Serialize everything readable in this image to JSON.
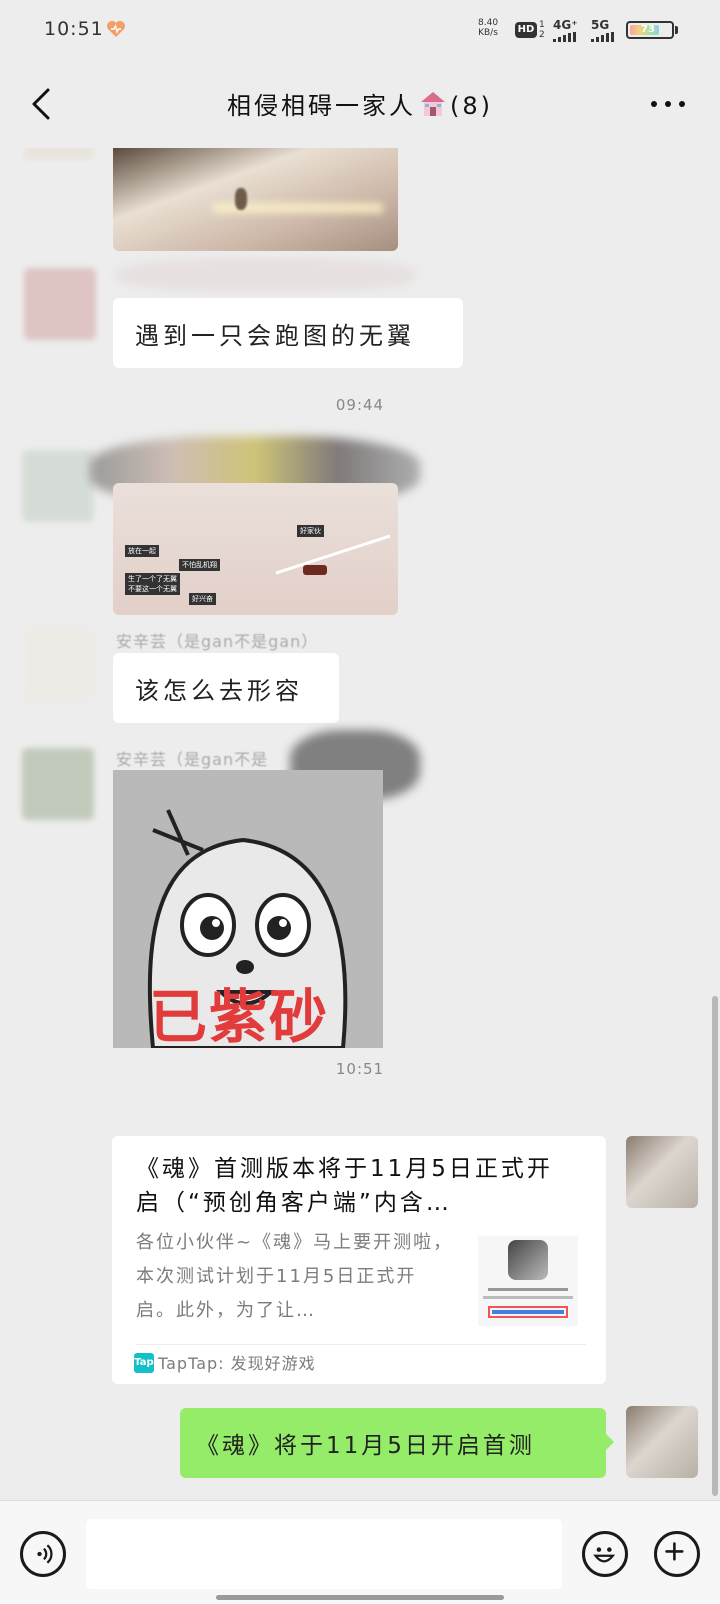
{
  "status_bar": {
    "time": "10:51",
    "net_speed_value": "8.40",
    "net_speed_unit": "KB/s",
    "hd_label": "HD",
    "hd_sub_top": "1",
    "hd_sub_bottom": "2",
    "network_1": "4G⁺",
    "network_2": "5G",
    "battery_level": "73",
    "battery_fraction": 0.73
  },
  "header": {
    "title": "相侵相碍一家人",
    "member_count": "(8)"
  },
  "messages": {
    "m2_text": "遇到一只会跑图的无翼",
    "time_1": "09:44",
    "sender_3": "安辛芸（是gan不是gan）",
    "m3_text": "该怎么去形容",
    "sender_4": "安辛芸（是gan不是",
    "sticker_text": "已紫砂",
    "time_2": "10:51",
    "screenshot_labels": [
      "放在一起",
      "不怕乱机翔",
      "生了一个了无翼",
      "不要这一个无翼",
      "好兴奋",
      "好家伙"
    ]
  },
  "link_card": {
    "title": "《魂》首测版本将于11月5日正式开启（“预创角客户端”内含…",
    "description": "各位小伙伴~《魂》马上要开测啦，本次测试计划于11月5日正式开启。此外，为了让…",
    "source_logo": "Tap",
    "source": "TapTap: 发现好游戏"
  },
  "last_message": {
    "text": "《魂》将于11月5日开启首测"
  },
  "input": {
    "placeholder": ""
  }
}
